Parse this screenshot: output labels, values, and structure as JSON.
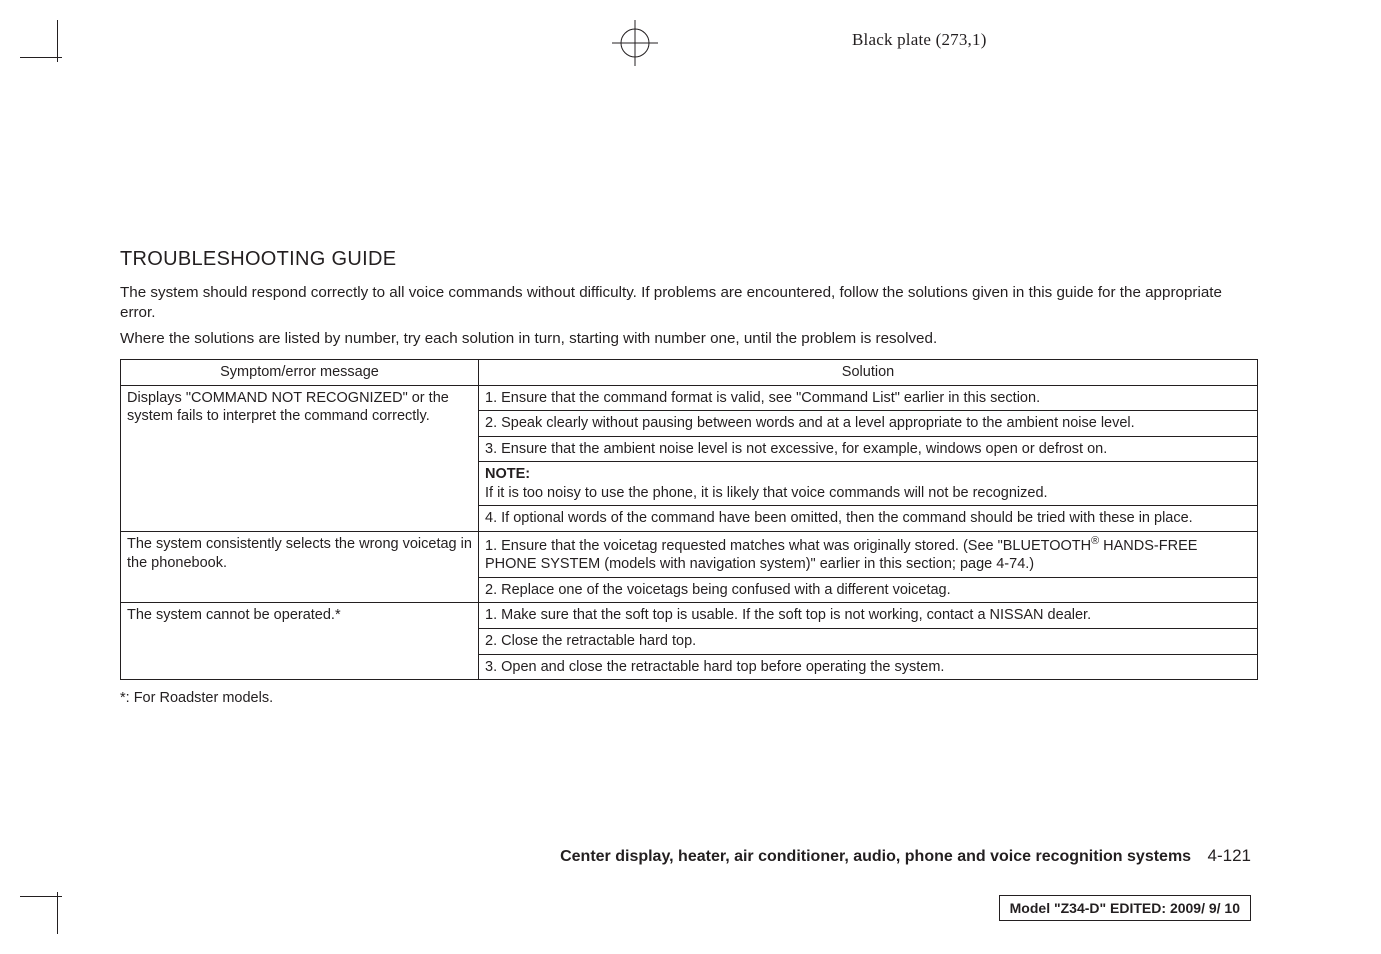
{
  "plate_label": "Black plate (273,1)",
  "heading": "TROUBLESHOOTING GUIDE",
  "intro1": "The system should respond correctly to all voice commands without difficulty. If problems are encountered, follow the solutions given in this guide for the appropriate error.",
  "intro2": "Where the solutions are listed by number, try each solution in turn, starting with number one, until the problem is resolved.",
  "table": {
    "head_symptom": "Symptom/error message",
    "head_solution": "Solution",
    "r1_sym": "Displays \"COMMAND NOT RECOGNIZED\" or the system fails to interpret the command correctly.",
    "r1a": "1. Ensure that the command format is valid, see \"Command List\" earlier in this section.",
    "r1b": "2. Speak clearly without pausing between words and at a level appropriate to the ambient noise level.",
    "r1c": "3. Ensure that the ambient noise level is not excessive, for example, windows open or defrost on.",
    "r1d_note": "NOTE:",
    "r1d_body": "If it is too noisy to use the phone, it is likely that voice commands will not be recognized.",
    "r1e": "4. If optional words of the command have been omitted, then the command should be tried with these in place.",
    "r2_sym": "The system consistently selects the wrong voicetag in the phonebook.",
    "r2a_pre": "1. Ensure that the voicetag requested matches what was originally stored. (See \"BLUETOOTH",
    "r2a_post": " HANDS-FREE PHONE SYSTEM (models with navigation system)\" earlier in this section; page 4-74.)",
    "r2b": "2. Replace one of the voicetags being confused with a different voicetag.",
    "r3_sym": "The system cannot be operated.*",
    "r3a": "1. Make sure that the soft top is usable. If the soft top is not working, contact a NISSAN dealer.",
    "r3b": "2. Close the retractable hard top.",
    "r3c": "3. Open and close the retractable hard top before operating the system."
  },
  "footnote": "*: For Roadster models.",
  "footer": {
    "section": "Center display, heater, air conditioner, audio, phone and voice recognition systems",
    "page": "4-121"
  },
  "model_box": {
    "model_label": "Model ",
    "model_value": "\"Z34-D\"",
    "edited_label": "   EDITED: ",
    "edited_value": " 2009/ 9/ 10"
  }
}
